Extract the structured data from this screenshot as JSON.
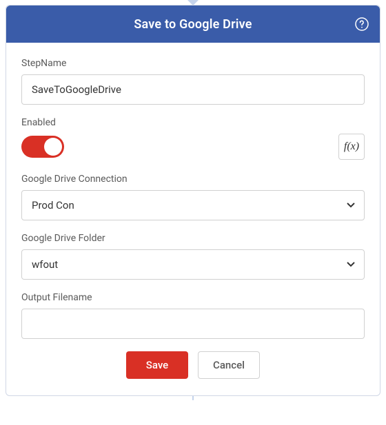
{
  "header": {
    "title": "Save to Google Drive"
  },
  "fields": {
    "stepName": {
      "label": "StepName",
      "value": "SaveToGoogleDrive"
    },
    "enabled": {
      "label": "Enabled",
      "value": true,
      "fx_label": "f(x)"
    },
    "connection": {
      "label": "Google Drive Connection",
      "value": "Prod Con"
    },
    "folder": {
      "label": "Google Drive Folder",
      "value": "wfout"
    },
    "outputFilename": {
      "label": "Output Filename",
      "value": ""
    }
  },
  "buttons": {
    "save": "Save",
    "cancel": "Cancel"
  },
  "colors": {
    "header_bg": "#3a5ca9",
    "accent": "#d93025"
  }
}
